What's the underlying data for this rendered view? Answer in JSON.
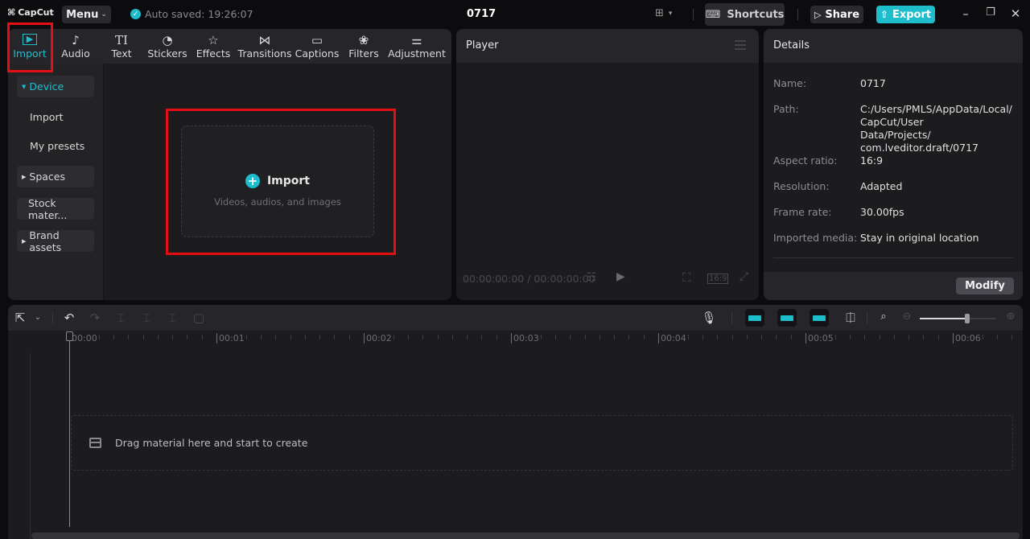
{
  "app": {
    "logo_text": "CapCut",
    "menu_label": "Menu",
    "autosave_text": "Auto saved: 19:26:07",
    "project_title": "0717",
    "shortcuts_label": "Shortcuts",
    "share_label": "Share",
    "export_label": "Export",
    "accent_color": "#1ebdcc",
    "highlight_color": "#e30f13"
  },
  "media": {
    "tabs": [
      {
        "label": "Import",
        "icon": "import-icon",
        "glyph": "▶",
        "active": true
      },
      {
        "label": "Audio",
        "icon": "audio-icon",
        "glyph": "♪"
      },
      {
        "label": "Text",
        "icon": "text-icon",
        "glyph": "TI"
      },
      {
        "label": "Stickers",
        "icon": "stickers-icon",
        "glyph": "◔"
      },
      {
        "label": "Effects",
        "icon": "effects-icon",
        "glyph": "☆"
      },
      {
        "label": "Transitions",
        "icon": "transitions-icon",
        "glyph": "⋈"
      },
      {
        "label": "Captions",
        "icon": "captions-icon",
        "glyph": "▭"
      },
      {
        "label": "Filters",
        "icon": "filters-icon",
        "glyph": "❀"
      },
      {
        "label": "Adjustment",
        "icon": "adjustment-icon",
        "glyph": "⚌"
      }
    ],
    "sidebar": [
      {
        "label": "Device",
        "expandable": true,
        "expanded": true,
        "active": true
      },
      {
        "label": "Import"
      },
      {
        "label": "My presets"
      },
      {
        "label": "Spaces",
        "expandable": true
      },
      {
        "label": "Stock mater..."
      },
      {
        "label": "Brand assets",
        "expandable": true
      }
    ],
    "dropzone": {
      "title": "Import",
      "subtitle": "Videos, audios, and images"
    }
  },
  "player": {
    "title": "Player",
    "timecode": "00:00:00:00 / 00:00:00:00",
    "ratio_label": "16:9"
  },
  "details": {
    "title": "Details",
    "rows": [
      {
        "label": "Name:",
        "value": "0717"
      },
      {
        "label": "Path:",
        "value": "C:/Users/PMLS/AppData/Local/ CapCut/User Data/Projects/ com.lveditor.draft/0717"
      },
      {
        "label": "Aspect ratio:",
        "value": "16:9"
      },
      {
        "label": "Resolution:",
        "value": "Adapted"
      },
      {
        "label": "Frame rate:",
        "value": "30.00fps"
      },
      {
        "label": "Imported media:",
        "value": "Stay in original location"
      }
    ],
    "modify_label": "Modify"
  },
  "timeline": {
    "ruler_labels": [
      "00:00",
      "00:01",
      "00:02",
      "00:03",
      "00:04",
      "00:05",
      "00:06"
    ],
    "drop_text": "Drag material here and start to create",
    "zoom_level": 0.62
  }
}
